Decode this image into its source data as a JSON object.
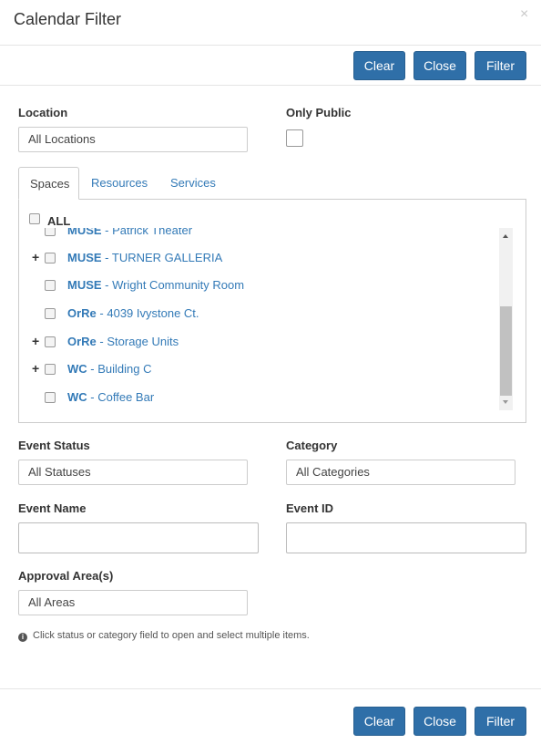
{
  "header": {
    "title": "Calendar Filter",
    "close_glyph": "×"
  },
  "buttons": {
    "clear": "Clear",
    "close": "Close",
    "filter": "Filter"
  },
  "location": {
    "label": "Location",
    "value": "All Locations"
  },
  "only_public": {
    "label": "Only Public",
    "checked": false
  },
  "tabs": [
    {
      "label": "Spaces",
      "active": true
    },
    {
      "label": "Resources",
      "active": false
    },
    {
      "label": "Services",
      "active": false
    }
  ],
  "spaces": {
    "all_label": "ALL",
    "items": [
      {
        "code": "MUSE",
        "sep": " - ",
        "name": "Patrick Theater",
        "expandable": false
      },
      {
        "code": "MUSE",
        "sep": " - ",
        "name": "TURNER GALLERIA",
        "expandable": true
      },
      {
        "code": "MUSE",
        "sep": " - ",
        "name": "Wright Community Room",
        "expandable": false
      },
      {
        "code": "OrRe",
        "sep": " - ",
        "name": "4039 Ivystone Ct.",
        "expandable": false
      },
      {
        "code": "OrRe",
        "sep": " - ",
        "name": "Storage Units",
        "expandable": true
      },
      {
        "code": "WC",
        "sep": " - ",
        "name": "Building C",
        "expandable": true
      },
      {
        "code": "WC",
        "sep": " - ",
        "name": "Coffee Bar",
        "expandable": false
      }
    ]
  },
  "event_status": {
    "label": "Event Status",
    "value": "All Statuses"
  },
  "category": {
    "label": "Category",
    "value": "All Categories"
  },
  "event_name": {
    "label": "Event Name",
    "value": ""
  },
  "event_id": {
    "label": "Event ID",
    "value": ""
  },
  "approval_area": {
    "label": "Approval Area(s)",
    "value": "All Areas"
  },
  "hint": {
    "icon": "info-icon",
    "text": "Click status or category field to open and select multiple items."
  },
  "colors": {
    "primary_button": "#2f6fa8",
    "link": "#337ab7"
  }
}
